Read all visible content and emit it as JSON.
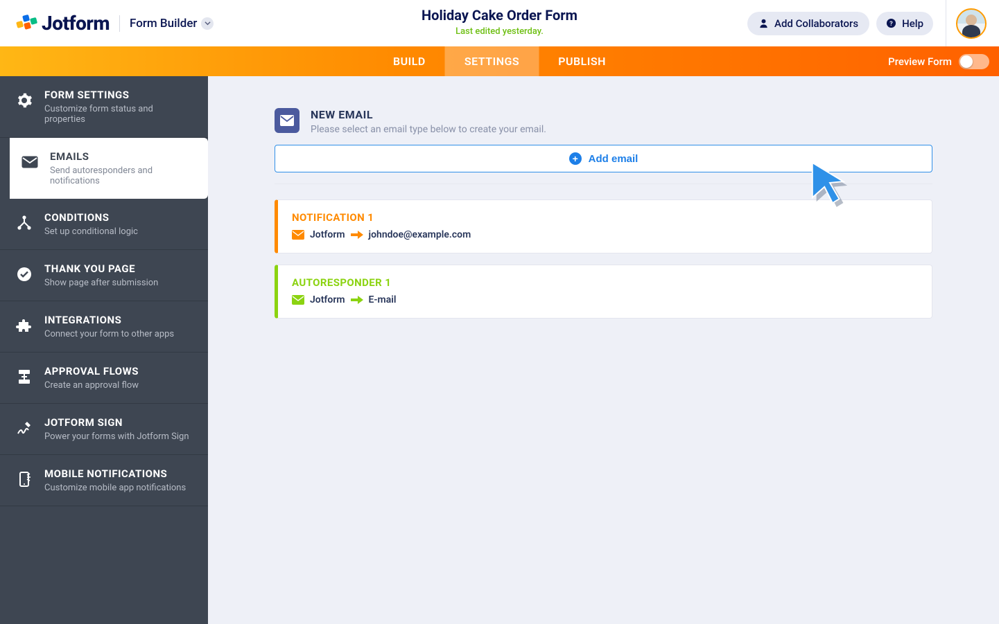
{
  "header": {
    "brand": "Jotform",
    "form_builder_label": "Form Builder",
    "form_title": "Holiday Cake Order Form",
    "edited_text": "Last edited yesterday.",
    "add_collab": "Add Collaborators",
    "help": "Help"
  },
  "tabs": {
    "build": "BUILD",
    "settings": "SETTINGS",
    "publish": "PUBLISH",
    "preview": "Preview Form"
  },
  "sidebar": [
    {
      "title": "FORM SETTINGS",
      "desc": "Customize form status and properties"
    },
    {
      "title": "EMAILS",
      "desc": "Send autoresponders and notifications"
    },
    {
      "title": "CONDITIONS",
      "desc": "Set up conditional logic"
    },
    {
      "title": "THANK YOU PAGE",
      "desc": "Show page after submission"
    },
    {
      "title": "INTEGRATIONS",
      "desc": "Connect your form to other apps"
    },
    {
      "title": "APPROVAL FLOWS",
      "desc": "Create an approval flow"
    },
    {
      "title": "JOTFORM SIGN",
      "desc": "Power your forms with Jotform Sign"
    },
    {
      "title": "MOBILE NOTIFICATIONS",
      "desc": "Customize mobile app notifications"
    }
  ],
  "main": {
    "section_title": "NEW EMAIL",
    "section_sub": "Please select an email type below to create your email.",
    "add_email": "Add email",
    "notification": {
      "label": "NOTIFICATION 1",
      "from": "Jotform",
      "to": "johndoe@example.com"
    },
    "autoresponder": {
      "label": "AUTORESPONDER 1",
      "from": "Jotform",
      "to": "E-mail"
    }
  }
}
